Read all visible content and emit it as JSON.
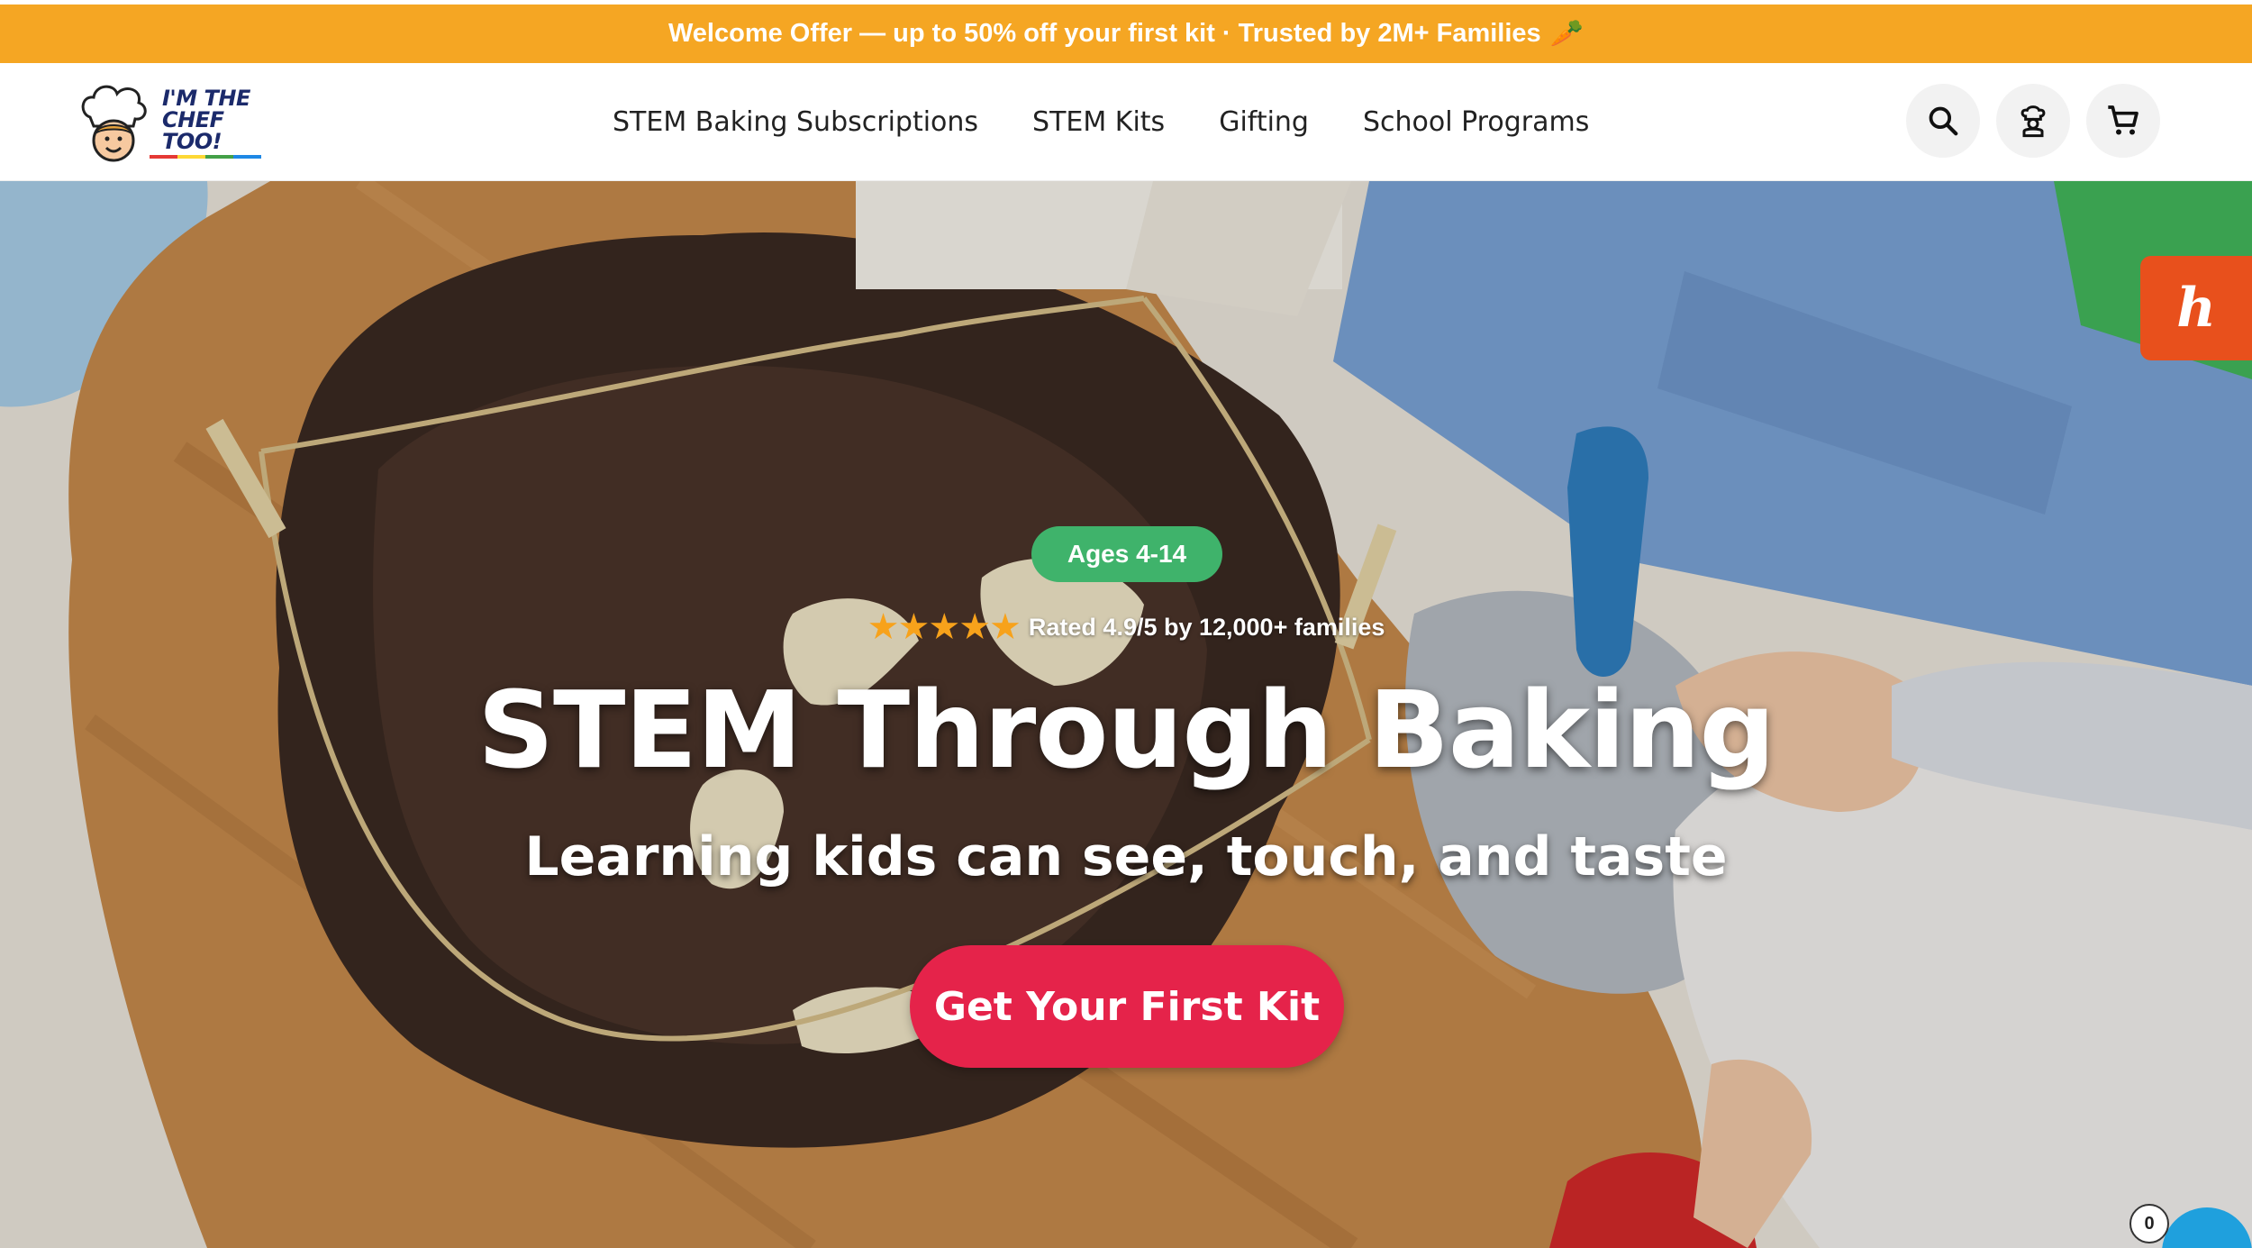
{
  "announcement": {
    "text": "Welcome Offer — up to 50% off your first kit · Trusted by 2M+ Families",
    "emoji_icon": "carrot-icon"
  },
  "header": {
    "logo_line1": "I'M THE",
    "logo_line2": "CHEF TOO!",
    "nav": [
      {
        "label": "STEM Baking Subscriptions"
      },
      {
        "label": "STEM Kits"
      },
      {
        "label": "Gifting"
      },
      {
        "label": "School Programs"
      }
    ],
    "icons": [
      "search-icon",
      "account-icon",
      "cart-icon"
    ]
  },
  "hero": {
    "badge": "Ages 4-14",
    "stars": "★★★★★",
    "rating_text": "Rated 4.9/5 by 12,000+ families",
    "title": "STEM Through Baking",
    "subtitle": "Learning kids can see, touch, and taste",
    "cta": "Get Your First Kit"
  },
  "widgets": {
    "honey_glyph": "h",
    "cart_count": "0"
  },
  "colors": {
    "announcement_bg": "#f5a623",
    "badge_green": "#3fb36b",
    "cta_red": "#e5234a",
    "star_orange": "#f7a21b",
    "honey_orange": "#e8501c"
  }
}
